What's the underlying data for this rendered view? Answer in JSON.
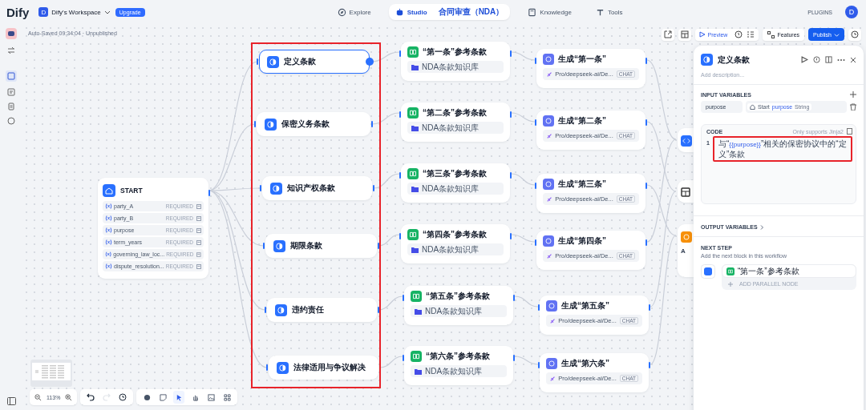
{
  "topbar": {
    "logo": "Dify",
    "workspace": {
      "initial": "D",
      "name": "Dify's Workspace"
    },
    "upgrade": "Upgrade",
    "nav": [
      {
        "kind": "explore",
        "label": "Explore",
        "selected": false
      },
      {
        "kind": "studio",
        "label": "Studio",
        "app": "合同审查（NDA）",
        "selected": true
      },
      {
        "kind": "knowledge",
        "label": "Knowledge",
        "selected": false
      },
      {
        "kind": "tools",
        "label": "Tools",
        "selected": false
      }
    ],
    "plugins": "PLUGINS",
    "avatar": "D"
  },
  "status": "Auto-Saved 09:34:04 · Unpublished",
  "actions": {
    "preview": "Preview",
    "features": "Features",
    "publish": "Publish"
  },
  "start": {
    "title": "START",
    "variables": [
      {
        "name": "party_A",
        "tag": "REQUIRED"
      },
      {
        "name": "party_B",
        "tag": "REQUIRED"
      },
      {
        "name": "purpose",
        "tag": "REQUIRED"
      },
      {
        "name": "term_years",
        "tag": "REQUIRED"
      },
      {
        "name": "governing_law_loc...",
        "tag": "REQUIRED"
      },
      {
        "name": "dispute_resolution...",
        "tag": "REQUIRED"
      }
    ]
  },
  "template_nodes": [
    {
      "title": "定义条款",
      "selected": true
    },
    {
      "title": "保密义务条款",
      "selected": false
    },
    {
      "title": "知识产权条款",
      "selected": false
    },
    {
      "title": "期限条款",
      "selected": false
    },
    {
      "title": "违约责任",
      "selected": false
    },
    {
      "title": "法律适用与争议解决",
      "selected": false
    }
  ],
  "knowledge_nodes": [
    {
      "title": "“第一条”参考条款",
      "source": "NDA条款知识库"
    },
    {
      "title": "“第二条”参考条款",
      "source": "NDA条款知识库"
    },
    {
      "title": "“第三条”参考条款",
      "source": "NDA条款知识库"
    },
    {
      "title": "“第四条”参考条款",
      "source": "NDA条款知识库"
    },
    {
      "title": "“第五条”参考条款",
      "source": "NDA条款知识库"
    },
    {
      "title": "“第六条”参考条款",
      "source": "NDA条款知识库"
    }
  ],
  "llm_nodes": [
    {
      "title": "生成“第一条”",
      "model": "Pro/deepseek-ai/De...",
      "badge": "CHAT"
    },
    {
      "title": "生成“第二条”",
      "model": "Pro/deepseek-ai/De...",
      "badge": "CHAT"
    },
    {
      "title": "生成“第三条”",
      "model": "Pro/deepseek-ai/De...",
      "badge": "CHAT"
    },
    {
      "title": "生成“第四条”",
      "model": "Pro/deepseek-ai/De...",
      "badge": "CHAT"
    },
    {
      "title": "生成“第五条”",
      "model": "Pro/deepseek-ai/De...",
      "badge": "CHAT"
    },
    {
      "title": "生成“第六条”",
      "model": "Pro/deepseek-ai/De...",
      "badge": "CHAT"
    }
  ],
  "partial_nodes": [
    {
      "kind": "code"
    },
    {
      "kind": "table"
    },
    {
      "kind": "llm",
      "label": "A"
    }
  ],
  "panel": {
    "title": "定义条款",
    "description_placeholder": "Add description...",
    "input_heading": "INPUT VARIABLES",
    "input": {
      "name": "purpose",
      "source": "Start",
      "variable": "purpose",
      "type": "String"
    },
    "code_label": "CODE",
    "code_hint": "Only supports Jinja2",
    "line_number": "1",
    "code_line": [
      {
        "kind": "plain",
        "text": "与“"
      },
      {
        "kind": "variable",
        "text": "{{purpose}}"
      },
      {
        "kind": "plain",
        "text": "”相关的保密协议中的“定义”条款"
      }
    ],
    "output_heading": "OUTPUT VARIABLES",
    "next_heading": "NEXT STEP",
    "next_hint": "Add the next block in this workflow",
    "next_node": "“第一条”参考条款",
    "add_parallel": "ADD PARALLEL NODE"
  },
  "zoom": "113%",
  "history": [
    {
      "kind": "undo",
      "disabled": false
    },
    {
      "kind": "redo",
      "disabled": true
    },
    {
      "kind": "history",
      "disabled": false
    }
  ],
  "tools": [
    {
      "kind": "add",
      "selected": false
    },
    {
      "kind": "note",
      "selected": false
    },
    {
      "kind": "pointer",
      "selected": true
    },
    {
      "kind": "hand",
      "selected": false
    },
    {
      "kind": "image",
      "selected": false
    },
    {
      "kind": "organize",
      "selected": false
    }
  ]
}
